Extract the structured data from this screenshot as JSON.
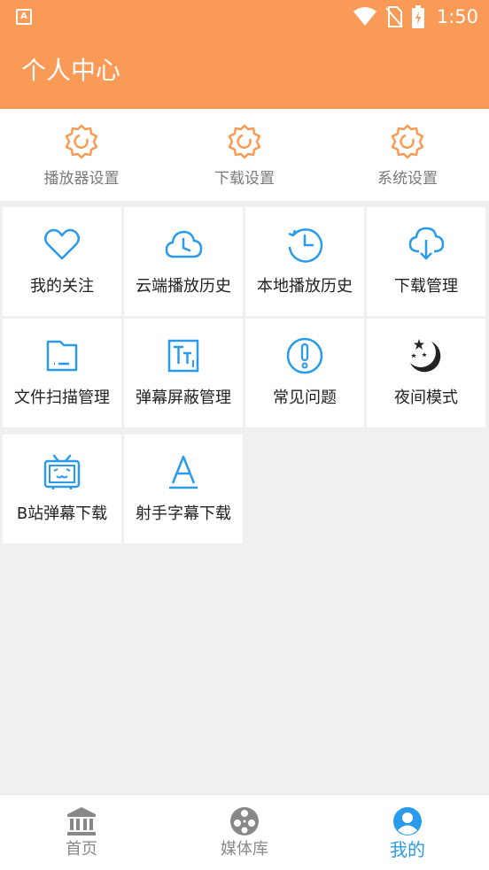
{
  "status_bar": {
    "time": "1:50",
    "app_icon": "a-icon",
    "icons": [
      "wifi-icon",
      "no-sim-icon",
      "battery-charging-icon"
    ]
  },
  "app_bar": {
    "title": "个人中心"
  },
  "settings": [
    {
      "label": "播放器设置",
      "icon": "gear-icon"
    },
    {
      "label": "下载设置",
      "icon": "gear-icon"
    },
    {
      "label": "系统设置",
      "icon": "gear-icon"
    }
  ],
  "grid": [
    {
      "label": "我的关注",
      "icon": "heart-icon"
    },
    {
      "label": "云端播放历史",
      "icon": "cloud-clock-icon"
    },
    {
      "label": "本地播放历史",
      "icon": "history-clock-icon"
    },
    {
      "label": "下载管理",
      "icon": "cloud-download-icon"
    },
    {
      "label": "文件扫描管理",
      "icon": "folder-icon"
    },
    {
      "label": "弹幕屏蔽管理",
      "icon": "text-block-icon"
    },
    {
      "label": "常见问题",
      "icon": "exclamation-icon"
    },
    {
      "label": "夜间模式",
      "icon": "moon-stars-icon"
    },
    {
      "label": "B站弹幕下载",
      "icon": "bilibili-tv-icon"
    },
    {
      "label": "射手字幕下载",
      "icon": "letter-a-icon"
    }
  ],
  "bottom_nav": [
    {
      "label": "首页",
      "icon": "bank-icon",
      "active": false
    },
    {
      "label": "媒体库",
      "icon": "film-reel-icon",
      "active": false
    },
    {
      "label": "我的",
      "icon": "account-circle-icon",
      "active": true
    }
  ],
  "colors": {
    "accent": "#f99a57",
    "icon_blue": "#2a9bea",
    "active_tab": "#2a9bea"
  }
}
